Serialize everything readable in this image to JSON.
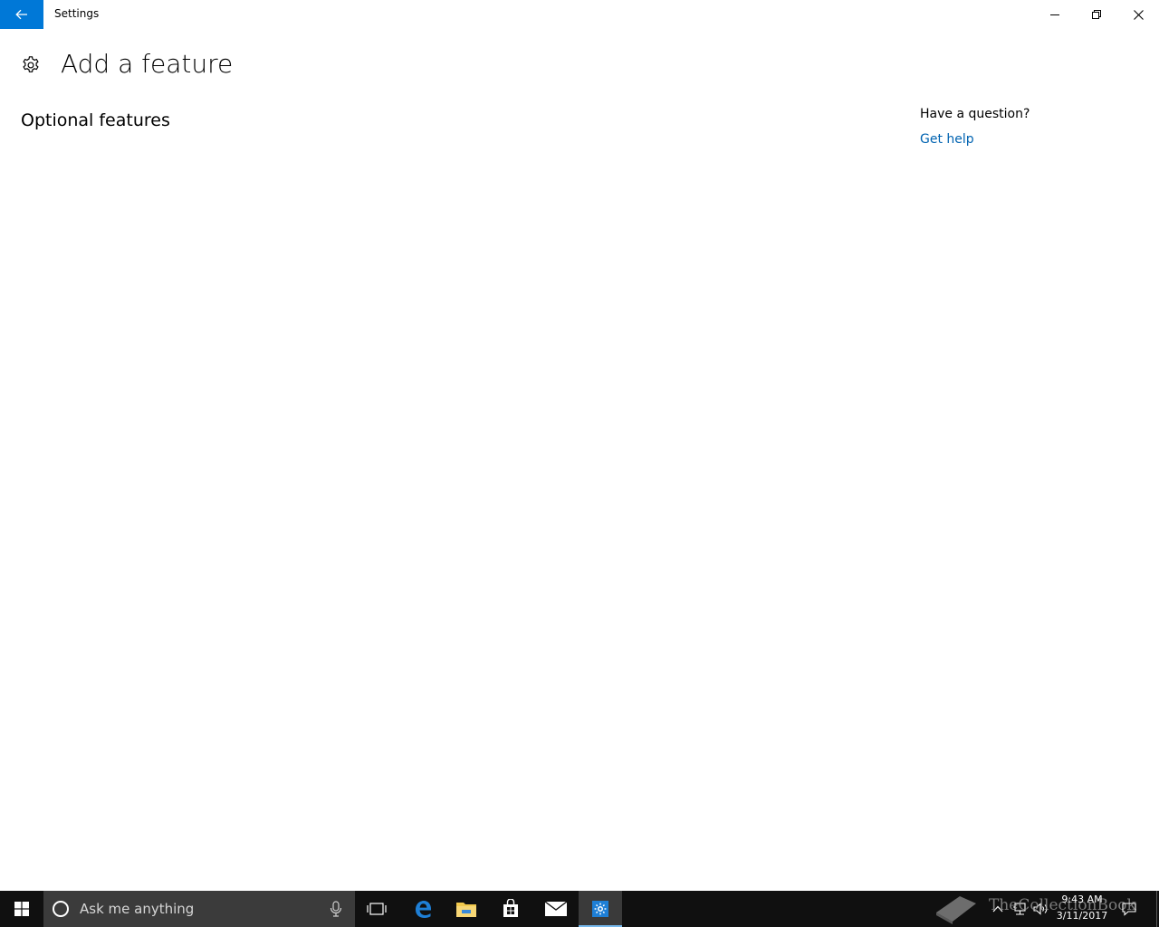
{
  "window": {
    "title": "Settings",
    "controls": {
      "minimize": "minimize-icon",
      "restore": "restore-icon",
      "close": "close-icon"
    },
    "back": "back-arrow-icon"
  },
  "page": {
    "title": "Add a feature",
    "icon": "gear-icon",
    "section_title": "Optional features"
  },
  "help": {
    "question": "Have a question?",
    "link": "Get help"
  },
  "taskbar": {
    "search_placeholder": "Ask me anything",
    "apps": [
      "task-view-icon",
      "edge-icon",
      "file-explorer-icon",
      "store-icon",
      "mail-icon",
      "settings-icon"
    ],
    "active_app": "settings-icon",
    "clock": {
      "time": "9:43 AM",
      "date": "3/11/2017"
    },
    "watermark": "TheCollectionBook"
  },
  "colors": {
    "accent": "#0078d7",
    "link": "#0063b1",
    "taskbar": "#101010",
    "search_box": "#3b3b3b"
  }
}
